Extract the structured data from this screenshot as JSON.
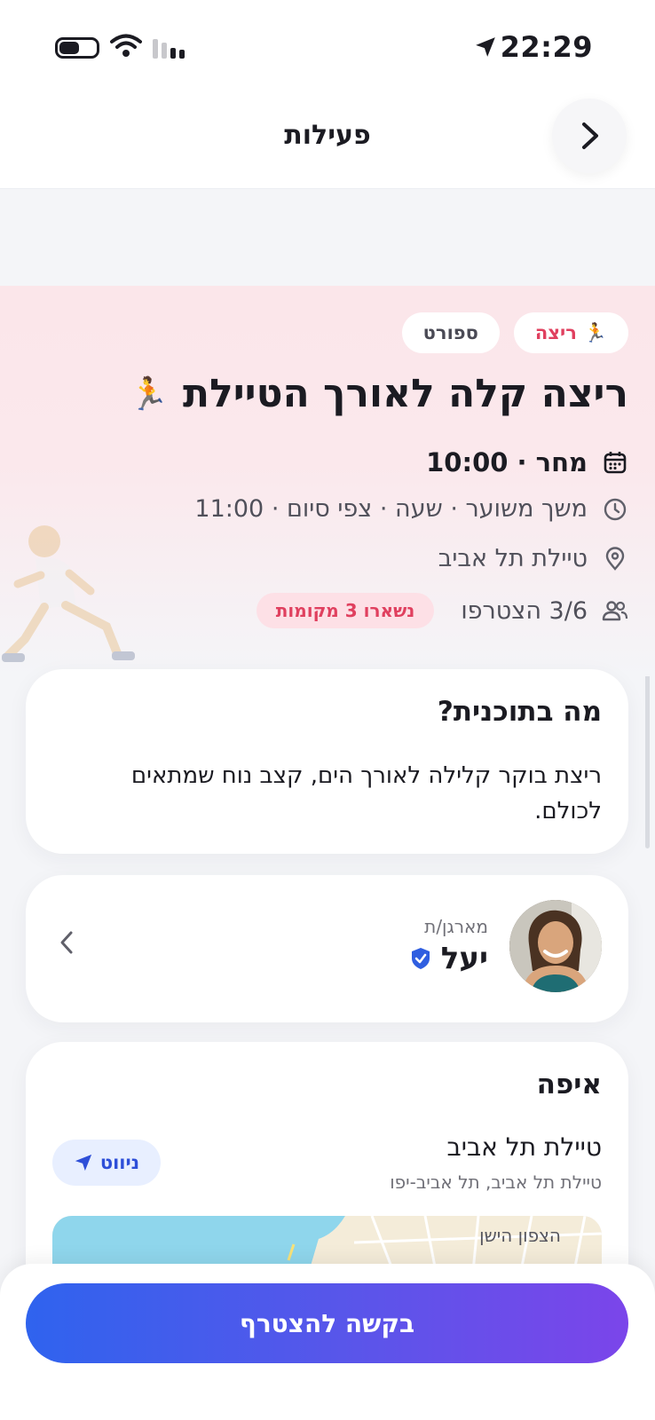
{
  "status_bar": {
    "time": "22:29"
  },
  "header": {
    "title": "פעילות"
  },
  "chips": [
    {
      "label": "ריצה",
      "emoji": "🏃"
    },
    {
      "label": "ספורט"
    }
  ],
  "event": {
    "title": "ריצה קלה לאורך הטיילת",
    "title_emoji": "🏃",
    "date": "מחר · 10:00",
    "duration": "משך משוער · שעה · צפי סיום · 11:00",
    "location": "טיילת תל אביב",
    "participants": "3/6 הצטרפו",
    "spots_left": "נשארו 3 מקומות"
  },
  "plan": {
    "heading": "מה בתוכנית?",
    "text": "ריצת בוקר קלילה לאורך הים, קצב נוח שמתאים לכולם."
  },
  "organizer": {
    "role": "מארגן/ת",
    "name": "יעל"
  },
  "where": {
    "heading": "איפה",
    "place": "טיילת תל אביב",
    "address": "טיילת תל אביב, תל אביב-יפו",
    "nav_label": "ניווט",
    "map_label": "הצפון הישן"
  },
  "cta": {
    "label": "בקשה להצטרף"
  },
  "colors": {
    "accent": "#e0405f",
    "primary_start": "#2f63ee",
    "primary_end": "#7b45ea",
    "verified": "#2f5ee0"
  },
  "icons": [
    "location-arrow-icon",
    "wifi-icon",
    "battery-icon",
    "signal-icon",
    "chevron-right-icon",
    "calendar-icon",
    "clock-icon",
    "pin-icon",
    "people-icon",
    "verified-icon",
    "chevron-left-icon",
    "navigate-icon"
  ]
}
